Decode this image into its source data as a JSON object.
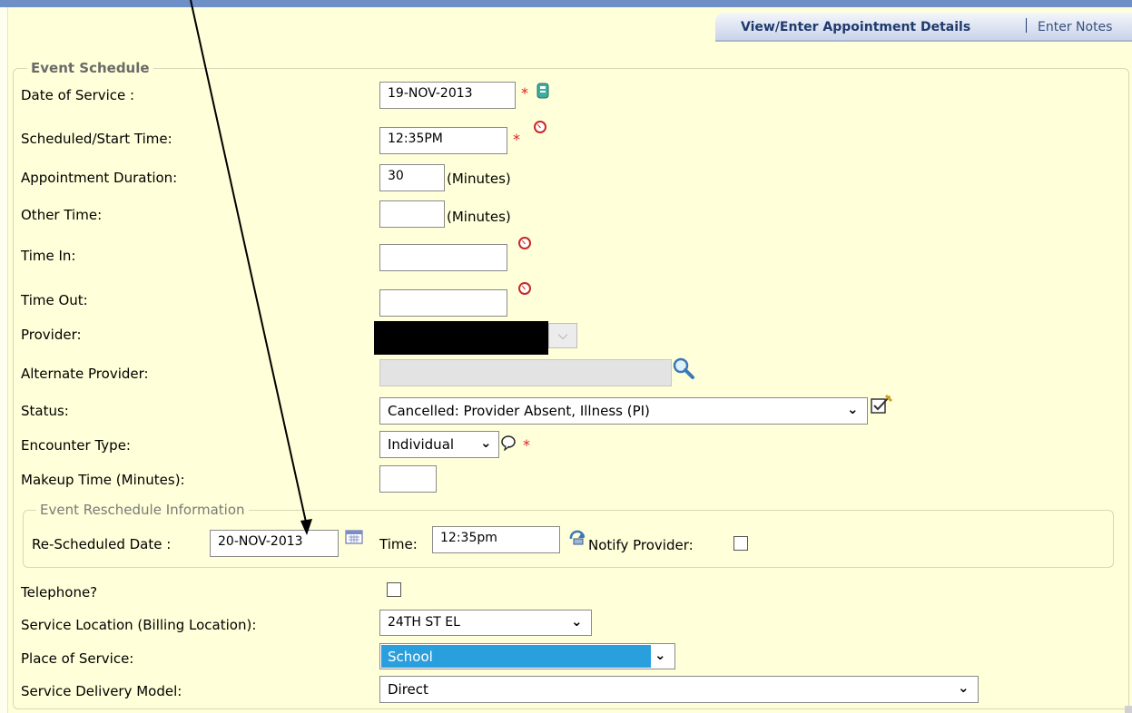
{
  "tabs": {
    "details": "View/Enter Appointment Details",
    "notes": "Enter Notes"
  },
  "event_schedule": {
    "legend": "Event Schedule",
    "date_of_service": {
      "label": "Date of Service :",
      "value": "19-NOV-2013",
      "required": "*"
    },
    "start_time": {
      "label": "Scheduled/Start Time:",
      "value": "12:35PM",
      "required": "*"
    },
    "duration": {
      "label": "Appointment Duration:",
      "value": "30",
      "unit": "(Minutes)"
    },
    "other_time": {
      "label": "Other Time:",
      "value": "",
      "unit": "(Minutes)"
    },
    "time_in": {
      "label": "Time In:",
      "value": ""
    },
    "time_out": {
      "label": "Time Out:",
      "value": ""
    },
    "provider": {
      "label": "Provider:",
      "value": ""
    },
    "alternate_provider": {
      "label": "Alternate Provider:",
      "value": ""
    },
    "status": {
      "label": "Status:",
      "value": "Cancelled: Provider Absent, Illness (PI)"
    },
    "encounter_type": {
      "label": "Encounter Type:",
      "value": "Individual",
      "required": "*"
    },
    "makeup_time": {
      "label": "Makeup Time (Minutes):",
      "value": ""
    }
  },
  "reschedule": {
    "legend": "Event Reschedule Information",
    "date_label": "Re-Scheduled Date :",
    "date_value": "20-NOV-2013",
    "time_label": "Time:",
    "time_value": "12:35pm",
    "notify_label": "Notify Provider:"
  },
  "telephone": {
    "label": "Telephone?"
  },
  "service_location": {
    "label": "Service Location (Billing Location):",
    "value": "24TH ST EL"
  },
  "place_of_service": {
    "label": "Place of Service:",
    "value": "School"
  },
  "service_delivery": {
    "label": "Service Delivery Model:",
    "value": "Direct"
  },
  "colors": {
    "header": "#6f8fc7",
    "background": "#ffffd9",
    "selected": "#2a9fdd"
  }
}
